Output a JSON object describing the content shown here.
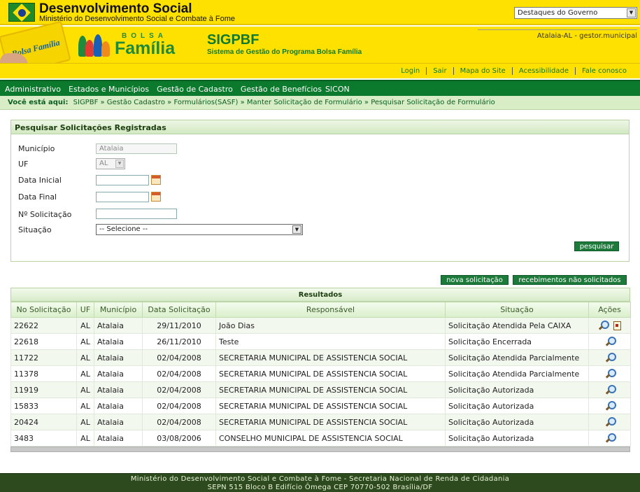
{
  "gov": {
    "title": "Desenvolvimento Social",
    "subtitle": "Ministério do Desenvolvimento Social e Combate à Fome",
    "select_value": "Destaques do Governo"
  },
  "brand": {
    "bolsa": "BOLSA",
    "familia": "Família",
    "card_text": "Bolsa Família",
    "system_name": "SIGPBF",
    "system_subtitle": "Sistema de Gestão do Programa Bolsa Família",
    "user_info": "Atalaia-AL - gestor.municipal"
  },
  "util_links": [
    "Login",
    "Sair",
    "Mapa do Site",
    "Acessibilidade",
    "Fale conosco"
  ],
  "nav": [
    "Administrativo",
    "Estados e Municípios",
    "Gestão de Cadastro",
    "Gestão de Benefícios",
    "SICON"
  ],
  "breadcrumb": {
    "label": "Você está aqui:",
    "path": "SIGPBF » Gestão Cadastro » Formulários(SASF) » Manter Solicitação de Formulário » Pesquisar Solicitação de Formulário"
  },
  "search": {
    "title": "Pesquisar Solicitações Registradas",
    "municipio_label": "Município",
    "municipio_value": "Atalaia",
    "uf_label": "UF",
    "uf_value": "AL",
    "data_inicial_label": "Data Inicial",
    "data_final_label": "Data Final",
    "num_solicitacao_label": "Nº Solicitação",
    "situacao_label": "Situação",
    "situacao_value": "-- Selecione --",
    "search_button": "pesquisar"
  },
  "actions": {
    "new_request": "nova solicitação",
    "unsolicited": "recebimentos não solicitados"
  },
  "results": {
    "title": "Resultados",
    "columns": [
      "No Solicitação",
      "UF",
      "Município",
      "Data Solicitação",
      "Responsável",
      "Situação",
      "Ações"
    ],
    "rows": [
      {
        "num": "22622",
        "uf": "AL",
        "municipio": "Atalaia",
        "data": "29/11/2010",
        "responsavel": "João Dias",
        "situacao": "Solicitação Atendida Pela CAIXA",
        "icons": [
          "search-icon",
          "document-icon"
        ]
      },
      {
        "num": "22618",
        "uf": "AL",
        "municipio": "Atalaia",
        "data": "26/11/2010",
        "responsavel": "Teste",
        "situacao": "Solicitação Encerrada",
        "icons": [
          "search-icon"
        ]
      },
      {
        "num": "11722",
        "uf": "AL",
        "municipio": "Atalaia",
        "data": "02/04/2008",
        "responsavel": "SECRETARIA MUNICIPAL DE ASSISTENCIA SOCIAL",
        "situacao": "Solicitação Atendida Parcialmente",
        "icons": [
          "search-icon"
        ]
      },
      {
        "num": "11378",
        "uf": "AL",
        "municipio": "Atalaia",
        "data": "02/04/2008",
        "responsavel": "SECRETARIA MUNICIPAL DE ASSISTENCIA SOCIAL",
        "situacao": "Solicitação Atendida Parcialmente",
        "icons": [
          "search-icon"
        ]
      },
      {
        "num": "11919",
        "uf": "AL",
        "municipio": "Atalaia",
        "data": "02/04/2008",
        "responsavel": "SECRETARIA MUNICIPAL DE ASSISTENCIA SOCIAL",
        "situacao": "Solicitação Autorizada",
        "icons": [
          "search-icon"
        ]
      },
      {
        "num": "15833",
        "uf": "AL",
        "municipio": "Atalaia",
        "data": "02/04/2008",
        "responsavel": "SECRETARIA MUNICIPAL DE ASSISTENCIA SOCIAL",
        "situacao": "Solicitação Autorizada",
        "icons": [
          "search-icon"
        ]
      },
      {
        "num": "20424",
        "uf": "AL",
        "municipio": "Atalaia",
        "data": "02/04/2008",
        "responsavel": "SECRETARIA MUNICIPAL DE ASSISTENCIA SOCIAL",
        "situacao": "Solicitação Autorizada",
        "icons": [
          "search-icon"
        ]
      },
      {
        "num": "3483",
        "uf": "AL",
        "municipio": "Atalaia",
        "data": "03/08/2006",
        "responsavel": "CONSELHO MUNICIPAL DE ASSISTENCIA SOCIAL",
        "situacao": "Solicitação Autorizada",
        "icons": [
          "search-icon"
        ]
      }
    ]
  },
  "footer": {
    "line1": "Ministério do Desenvolvimento Social e Combate à Fome - Secretaria Nacional de Renda de Cidadania",
    "line2": "SEPN 515 Bloco B Edifício Ômega CEP 70770-502 Brasília/DF"
  },
  "colors": {
    "brand_yellow": "#ffe100",
    "brand_green": "#0b7a2c",
    "footer_green": "#2d4a1f"
  }
}
